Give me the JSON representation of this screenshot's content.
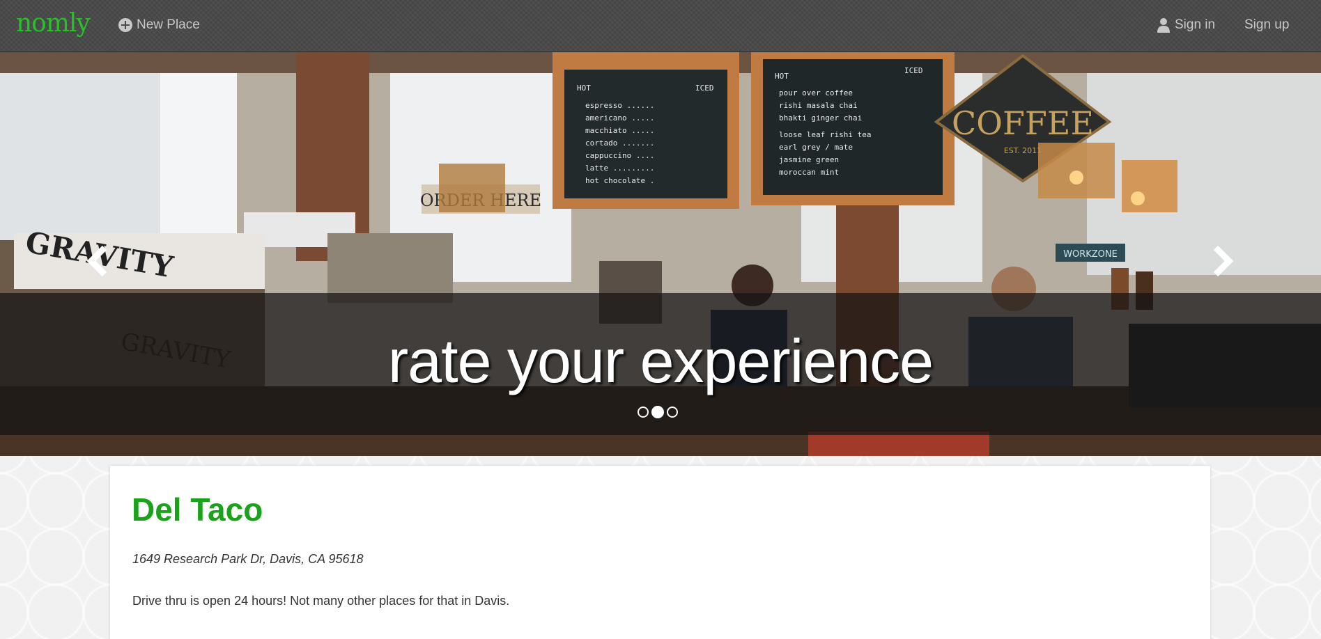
{
  "navbar": {
    "brand": "nomly",
    "new_place": "New Place",
    "sign_in": "Sign in",
    "sign_up": "Sign up"
  },
  "carousel": {
    "caption": "rate your experience",
    "slide_count": 3,
    "active_index": 1
  },
  "place": {
    "name": "Del Taco",
    "address": "1649 Research Park Dr, Davis, CA 95618",
    "description": "Drive thru is open 24 hours! Not many other places for that in Davis."
  },
  "colors": {
    "brand_green": "#27c227",
    "title_green": "#1aa31a",
    "navbar": "#4a4a4a"
  },
  "icons": {
    "new_place": "plus-circle-icon",
    "sign_in": "user-icon",
    "prev": "chevron-left-icon",
    "next": "chevron-right-icon"
  }
}
